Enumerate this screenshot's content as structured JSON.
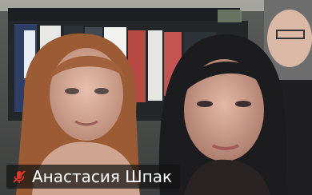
{
  "participant": {
    "name": "Анастасия Шпак",
    "muted": true
  },
  "icons": {
    "mic_status": "mic-muted-icon"
  },
  "colors": {
    "mute_red": "#e0342c",
    "label_bg": "#141414",
    "label_text": "#ffffff"
  }
}
